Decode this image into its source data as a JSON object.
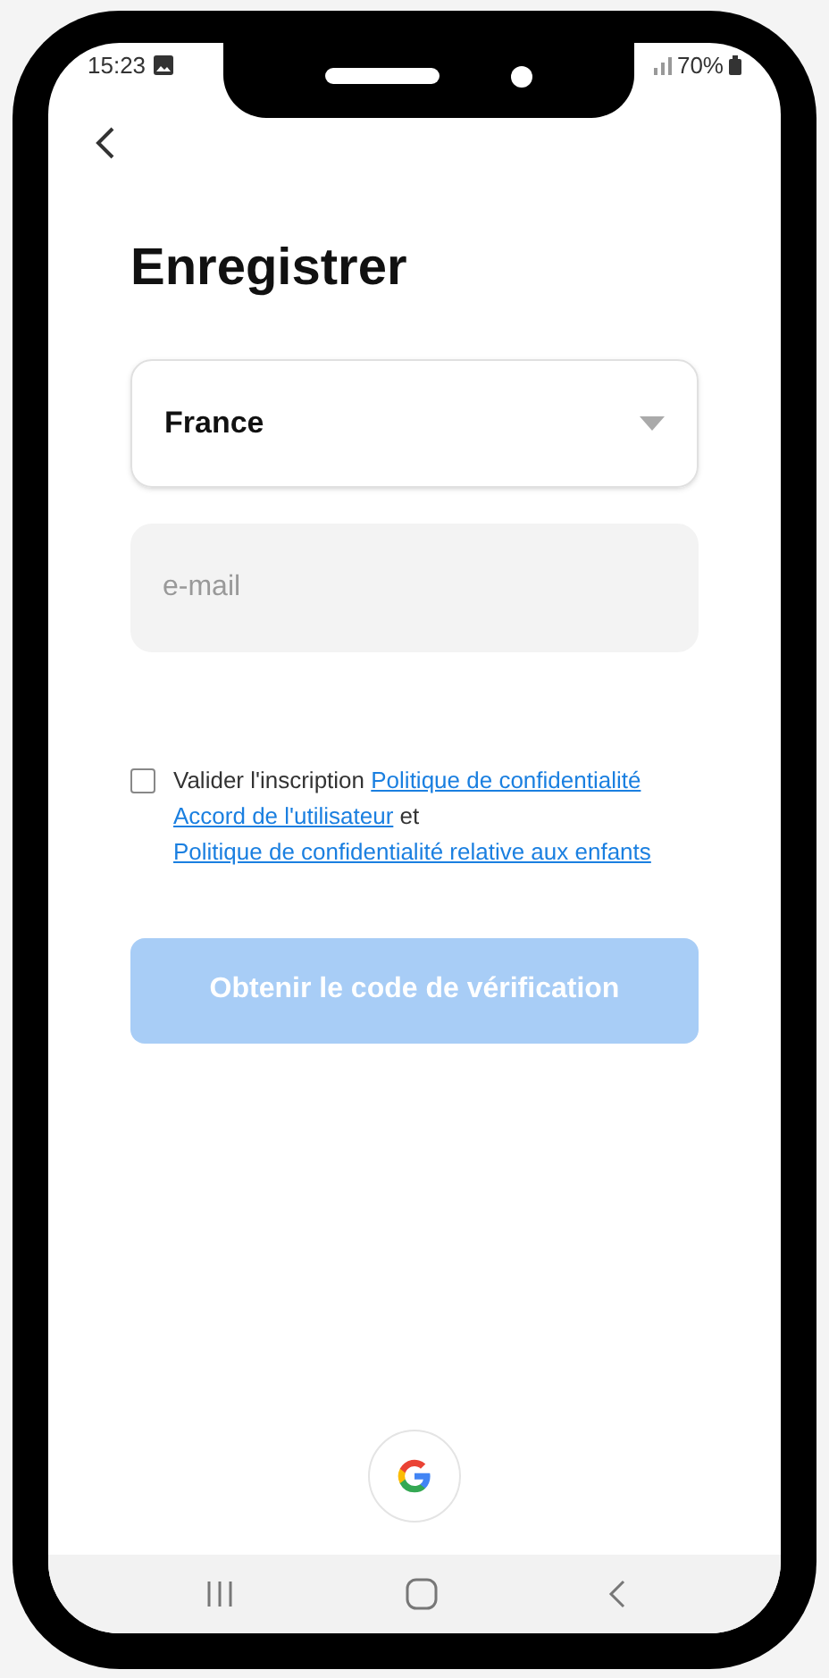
{
  "status_bar": {
    "time": "15:23",
    "battery": "70%"
  },
  "title": "Enregistrer",
  "country_select": {
    "value": "France"
  },
  "email_field": {
    "placeholder": "e-mail"
  },
  "consent": {
    "checked": false,
    "parts": [
      {
        "kind": "text",
        "text": "Valider l'inscription"
      },
      {
        "kind": "link",
        "text": "Politique de confidentialité"
      },
      {
        "kind": "link",
        "text": "Accord de l'utilisateur"
      },
      {
        "kind": "text",
        "text": "et"
      },
      {
        "kind": "link",
        "text": "Politique de confidentialité relative aux enfants"
      }
    ]
  },
  "submit_button": {
    "label": "Obtenir le code de vérification",
    "disabled": true
  }
}
